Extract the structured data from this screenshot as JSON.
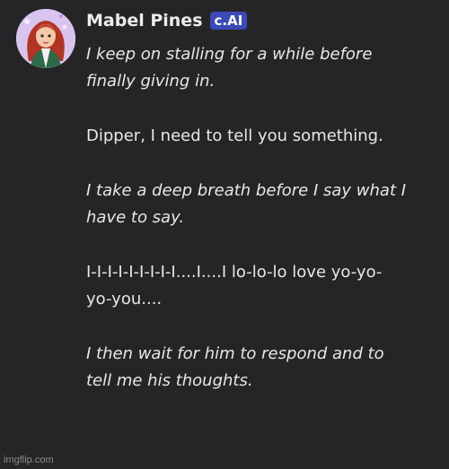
{
  "character": {
    "name": "Mabel Pines",
    "badge": "c.AI",
    "avatar_icon": "character-avatar"
  },
  "message": {
    "paragraphs": [
      {
        "text": "I keep on stalling for a while before\nfinally giving in.",
        "style": "action"
      },
      {
        "text": "Dipper, I need to tell you something.",
        "style": "speech"
      },
      {
        "text": "I take a deep breath before I say what I\nhave to say.",
        "style": "action"
      },
      {
        "text": "I-I-I-I-I-I-I-I-I....I....I lo-lo-lo love yo-yo-\nyo-you....",
        "style": "speech"
      },
      {
        "text": "I then wait for him to respond and to\ntell me his thoughts.",
        "style": "action"
      }
    ]
  },
  "watermark": "imgflip.com",
  "colors": {
    "background": "#252527",
    "badge": "#3b4ab8",
    "text": "#e7e7e9"
  }
}
